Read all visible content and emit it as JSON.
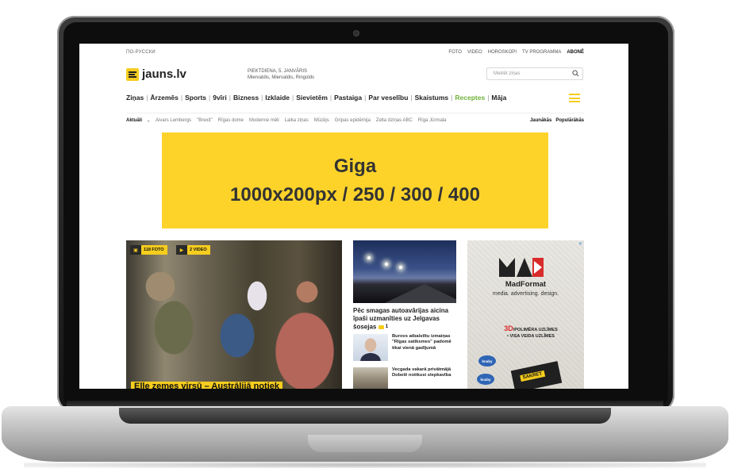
{
  "topbar": {
    "lang": "ПО-РУССКИ",
    "links": [
      "FOTO",
      "VIDEO",
      "HOROSKOPI",
      "TV PROGRAMMA"
    ],
    "subscribe": "ABONĒ"
  },
  "header": {
    "logo": "jauns.lv",
    "date": "PIEKTDIENA, 5. JANVĀRIS",
    "namedays": "Miervaldis, Miervaldis, Ringolds",
    "search_placeholder": "Meklēt ziņas"
  },
  "nav": {
    "items": [
      "Ziņas",
      "Ārzemēs",
      "Sports",
      "9vīri",
      "Bizness",
      "Izklaide",
      "Sievietēm",
      "Pastaiga",
      "Par veselību",
      "Skaistums",
      "Receptes",
      "Māja"
    ],
    "highlight_color": "#6fb33a"
  },
  "trending": {
    "label": "Aktuāli",
    "items": [
      "Aivars Lembergs",
      "\"Brexit\"",
      "Rīgas dome",
      "Modernie mēli",
      "Laika ziņas",
      "Mūzējs",
      "Gripas epidēmija",
      "Zelta dziņas ABC",
      "Rīga Jūrmala"
    ],
    "right": [
      "Jaunākās",
      "Populārākās"
    ]
  },
  "ad_banner": {
    "line1": "Giga",
    "line2": "1000x200px / 250 / 300 / 400",
    "color": "#fdd32a"
  },
  "main_story": {
    "photo_badge": "118 FOTO",
    "video_badge": "2 VIDEO",
    "headline": "Elle zemes virsū – Austrālijā notiek"
  },
  "mid_story": {
    "headline": "Pēc smagas autoavārijas aicina īpaši uzmanīties uz Jelgavas šosejas",
    "comments": "1"
  },
  "mini_stories": [
    {
      "text": "Burovs atbalstītu izmaiņas \"Rīgas satiksmes\" padomē tikai vienā gadījumā"
    },
    {
      "text": "Vecgada vakarā privātmājā Dobelē notikusi slepkavība"
    }
  ],
  "right_ad": {
    "close": "✕",
    "brand": "MadFormat",
    "tagline": "media. advertising. design.",
    "product_line1": "3D",
    "product_line1b": "/POLIMĒRA UZLĪMES",
    "product_line2": "• VISA VEIDA UZLĪMES",
    "bubble1": "knaby",
    "bubble2": "knaby",
    "ticket": "SAKRET"
  },
  "colors": {
    "brand_yellow": "#f5cd1e",
    "text_dark": "#222222"
  }
}
